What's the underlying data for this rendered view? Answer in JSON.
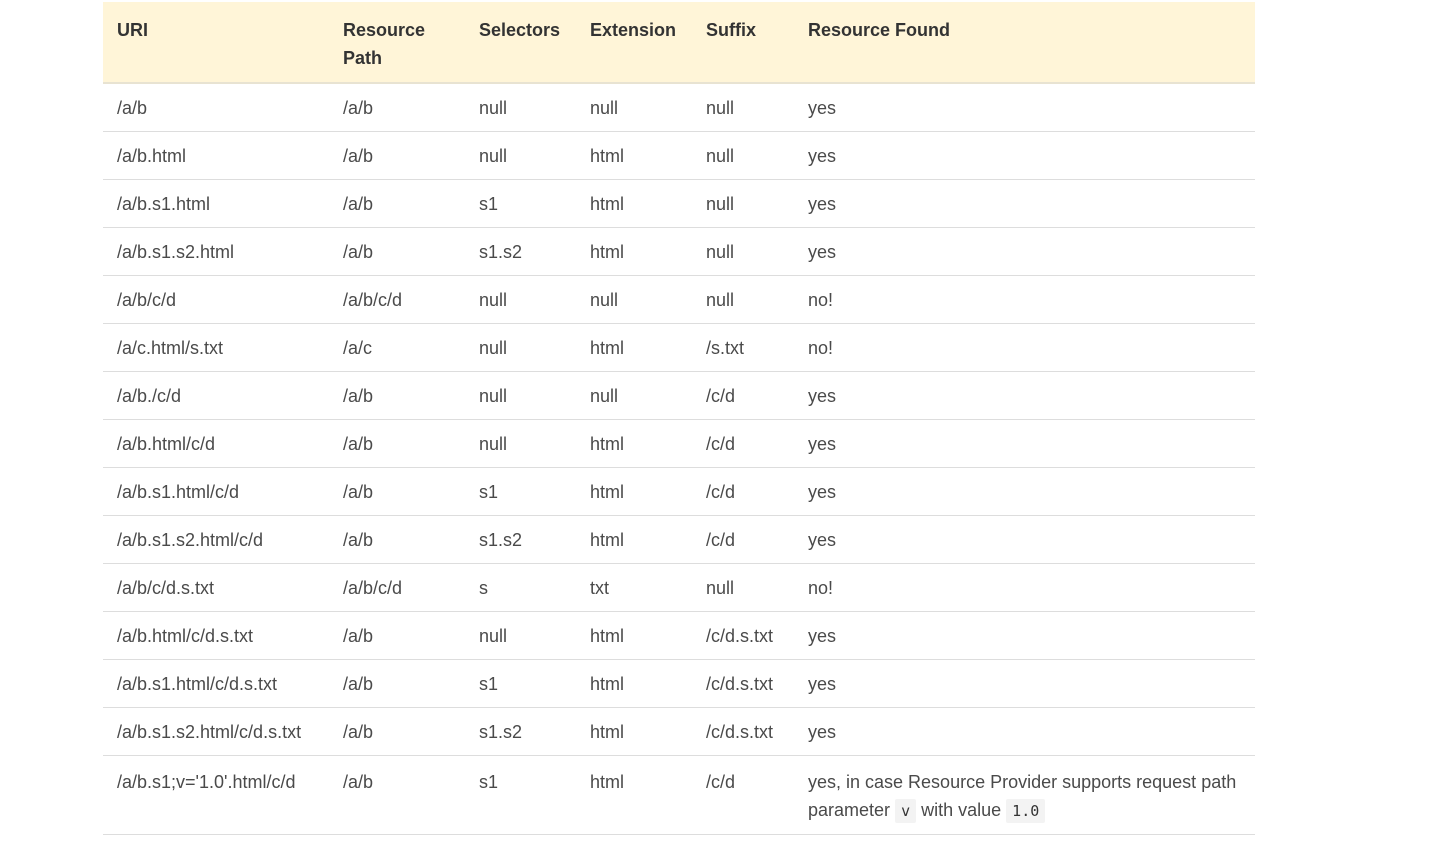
{
  "table": {
    "headers": {
      "uri": "URI",
      "resource_path": "Resource Path",
      "selectors": "Selectors",
      "extension": "Extension",
      "suffix": "Suffix",
      "resource_found": "Resource Found"
    },
    "rows": [
      {
        "uri": "/a/b",
        "resource_path": "/a/b",
        "selectors": "null",
        "extension": "null",
        "suffix": "null",
        "resource_found": "yes"
      },
      {
        "uri": "/a/b.html",
        "resource_path": "/a/b",
        "selectors": "null",
        "extension": "html",
        "suffix": "null",
        "resource_found": "yes"
      },
      {
        "uri": "/a/b.s1.html",
        "resource_path": "/a/b",
        "selectors": "s1",
        "extension": "html",
        "suffix": "null",
        "resource_found": "yes"
      },
      {
        "uri": "/a/b.s1.s2.html",
        "resource_path": "/a/b",
        "selectors": "s1.s2",
        "extension": "html",
        "suffix": "null",
        "resource_found": "yes"
      },
      {
        "uri": "/a/b/c/d",
        "resource_path": "/a/b/c/d",
        "selectors": "null",
        "extension": "null",
        "suffix": "null",
        "resource_found": "no!"
      },
      {
        "uri": "/a/c.html/s.txt",
        "resource_path": "/a/c",
        "selectors": "null",
        "extension": "html",
        "suffix": "/s.txt",
        "resource_found": "no!"
      },
      {
        "uri": "/a/b./c/d",
        "resource_path": "/a/b",
        "selectors": "null",
        "extension": "null",
        "suffix": "/c/d",
        "resource_found": "yes"
      },
      {
        "uri": "/a/b.html/c/d",
        "resource_path": "/a/b",
        "selectors": "null",
        "extension": "html",
        "suffix": "/c/d",
        "resource_found": "yes"
      },
      {
        "uri": "/a/b.s1.html/c/d",
        "resource_path": "/a/b",
        "selectors": "s1",
        "extension": "html",
        "suffix": "/c/d",
        "resource_found": "yes"
      },
      {
        "uri": "/a/b.s1.s2.html/c/d",
        "resource_path": "/a/b",
        "selectors": "s1.s2",
        "extension": "html",
        "suffix": "/c/d",
        "resource_found": "yes"
      },
      {
        "uri": "/a/b/c/d.s.txt",
        "resource_path": "/a/b/c/d",
        "selectors": "s",
        "extension": "txt",
        "suffix": "null",
        "resource_found": "no!"
      },
      {
        "uri": "/a/b.html/c/d.s.txt",
        "resource_path": "/a/b",
        "selectors": "null",
        "extension": "html",
        "suffix": "/c/d.s.txt",
        "resource_found": "yes"
      },
      {
        "uri": "/a/b.s1.html/c/d.s.txt",
        "resource_path": "/a/b",
        "selectors": "s1",
        "extension": "html",
        "suffix": "/c/d.s.txt",
        "resource_found": "yes"
      },
      {
        "uri": "/a/b.s1.s2.html/c/d.s.txt",
        "resource_path": "/a/b",
        "selectors": "s1.s2",
        "extension": "html",
        "suffix": "/c/d.s.txt",
        "resource_found": "yes"
      }
    ],
    "last_row": {
      "uri": "/a/b.s1;v='1.0'.html/c/d",
      "resource_path": "/a/b",
      "selectors": "s1",
      "extension": "html",
      "suffix": "/c/d",
      "resource_found": {
        "text_before": "yes, in case Resource Provider supports request path parameter",
        "param_name": "v",
        "text_middle": "with value",
        "param_value": "1.0"
      }
    }
  }
}
